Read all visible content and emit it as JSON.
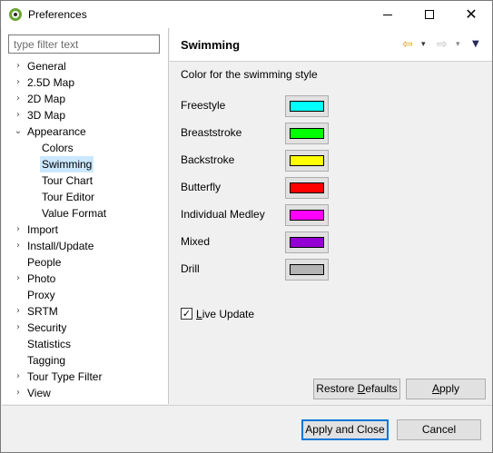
{
  "window": {
    "title": "Preferences",
    "minimize_symbol": "—",
    "close_symbol": "✕"
  },
  "filter": {
    "placeholder": "type filter text",
    "value": ""
  },
  "tree": [
    {
      "label": "General",
      "expandable": true,
      "expanded": false,
      "level": 0
    },
    {
      "label": "2.5D Map",
      "expandable": true,
      "expanded": false,
      "level": 0
    },
    {
      "label": "2D Map",
      "expandable": true,
      "expanded": false,
      "level": 0
    },
    {
      "label": "3D Map",
      "expandable": true,
      "expanded": false,
      "level": 0
    },
    {
      "label": "Appearance",
      "expandable": true,
      "expanded": true,
      "level": 0
    },
    {
      "label": "Colors",
      "expandable": false,
      "level": 1
    },
    {
      "label": "Swimming",
      "expandable": false,
      "level": 1,
      "selected": true
    },
    {
      "label": "Tour Chart",
      "expandable": false,
      "level": 1
    },
    {
      "label": "Tour Editor",
      "expandable": false,
      "level": 1
    },
    {
      "label": "Value Format",
      "expandable": false,
      "level": 1
    },
    {
      "label": "Import",
      "expandable": true,
      "expanded": false,
      "level": 0
    },
    {
      "label": "Install/Update",
      "expandable": true,
      "expanded": false,
      "level": 0
    },
    {
      "label": "People",
      "expandable": false,
      "level": 0
    },
    {
      "label": "Photo",
      "expandable": true,
      "expanded": false,
      "level": 0
    },
    {
      "label": "Proxy",
      "expandable": false,
      "level": 0
    },
    {
      "label": "SRTM",
      "expandable": true,
      "expanded": false,
      "level": 0
    },
    {
      "label": "Security",
      "expandable": true,
      "expanded": false,
      "level": 0
    },
    {
      "label": "Statistics",
      "expandable": false,
      "level": 0
    },
    {
      "label": "Tagging",
      "expandable": false,
      "level": 0
    },
    {
      "label": "Tour Type Filter",
      "expandable": true,
      "expanded": false,
      "level": 0
    },
    {
      "label": "View",
      "expandable": true,
      "expanded": false,
      "level": 0
    }
  ],
  "page": {
    "title": "Swimming",
    "description": "Color for the swimming style",
    "nav": {
      "back_icon": "⇦",
      "forward_icon": "⇨",
      "dropdown_icon": "▾",
      "view_menu_icon": "▼"
    }
  },
  "styles": [
    {
      "label": "Freestyle",
      "color": "#00ffff"
    },
    {
      "label": "Breaststroke",
      "color": "#00ff00"
    },
    {
      "label": "Backstroke",
      "color": "#ffff00"
    },
    {
      "label": "Butterfly",
      "color": "#ff0000"
    },
    {
      "label": "Individual Medley",
      "color": "#ff00ff"
    },
    {
      "label": "Mixed",
      "color": "#9400d3"
    },
    {
      "label": "Drill",
      "color": "#b4b4b4"
    }
  ],
  "live_update": {
    "label": "Live Update",
    "checked": true,
    "check_glyph": "✓"
  },
  "buttons": {
    "restore_defaults": "Restore Defaults",
    "apply": "Apply",
    "apply_and_close": "Apply and Close",
    "cancel": "Cancel"
  }
}
